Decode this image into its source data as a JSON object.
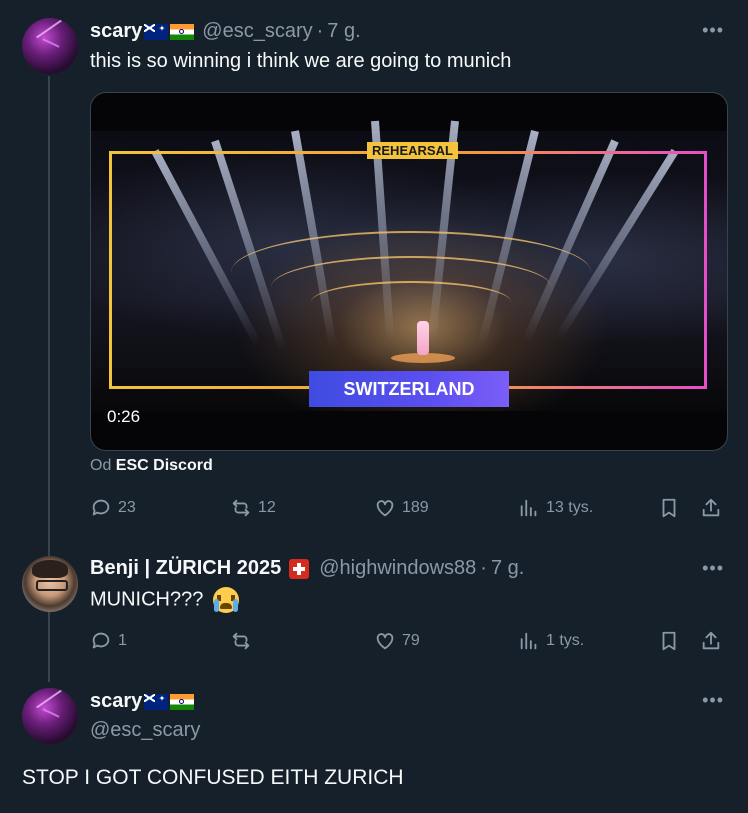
{
  "tweets": [
    {
      "name": "scary",
      "handle": "@esc_scary",
      "time": "7 g.",
      "text": "this is so winning i think we are going to munich",
      "media": {
        "banner": "REHEARSAL",
        "country": "SWITZERLAND",
        "duration": "0:26"
      },
      "source_prefix": "Od",
      "source_name": "ESC Discord",
      "replies": "23",
      "reposts": "12",
      "likes": "189",
      "views": "13 tys."
    },
    {
      "name": "Benji | ZÜRICH 2025",
      "handle": "@highwindows88",
      "time": "7 g.",
      "text": "MUNICH???",
      "replies": "1",
      "reposts": "",
      "likes": "79",
      "views": "1 tys."
    },
    {
      "name": "scary",
      "handle": "@esc_scary",
      "text": "STOP I GOT CONFUSED EITH ZURICH"
    }
  ],
  "icons": [
    "more-icon",
    "reply-icon",
    "repost-icon",
    "like-icon",
    "views-icon",
    "bookmark-icon",
    "share-icon"
  ],
  "colors": {
    "background": "#15202b",
    "text": "#f7f9f9",
    "muted": "#8b98a5",
    "thread_line": "#38444d"
  }
}
